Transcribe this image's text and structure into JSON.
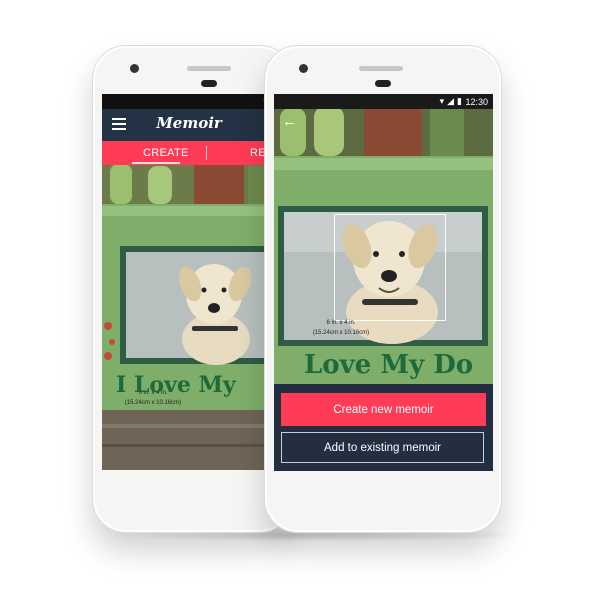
{
  "back_phone": {
    "app_title": "Memoir",
    "tabs": [
      {
        "label": "CREATE",
        "selected": true
      },
      {
        "label": "RE",
        "selected": false
      }
    ],
    "frame_text": "I Love My",
    "size_label_line1": "6 in. x 4 in.",
    "size_label_line2": "(15.24cm x 10.16cm)"
  },
  "front_phone": {
    "status_time": "12:30",
    "frame_text": "Love My Do",
    "size_label_line1": "6 in. x 4 in.",
    "size_label_line2": "(15.24cm x 10.16cm)",
    "primary_button": "Create new memoir",
    "secondary_button": "Add to existing memoir"
  },
  "colors": {
    "accent": "#ff3b55",
    "app_bar": "#243245",
    "panel": "#232e40",
    "frame_green": "#7fae6a",
    "frame_text": "#1f6a3c"
  },
  "icons": [
    "menu-icon",
    "back-arrow-icon",
    "wifi-icon",
    "signal-icon",
    "battery-icon"
  ]
}
